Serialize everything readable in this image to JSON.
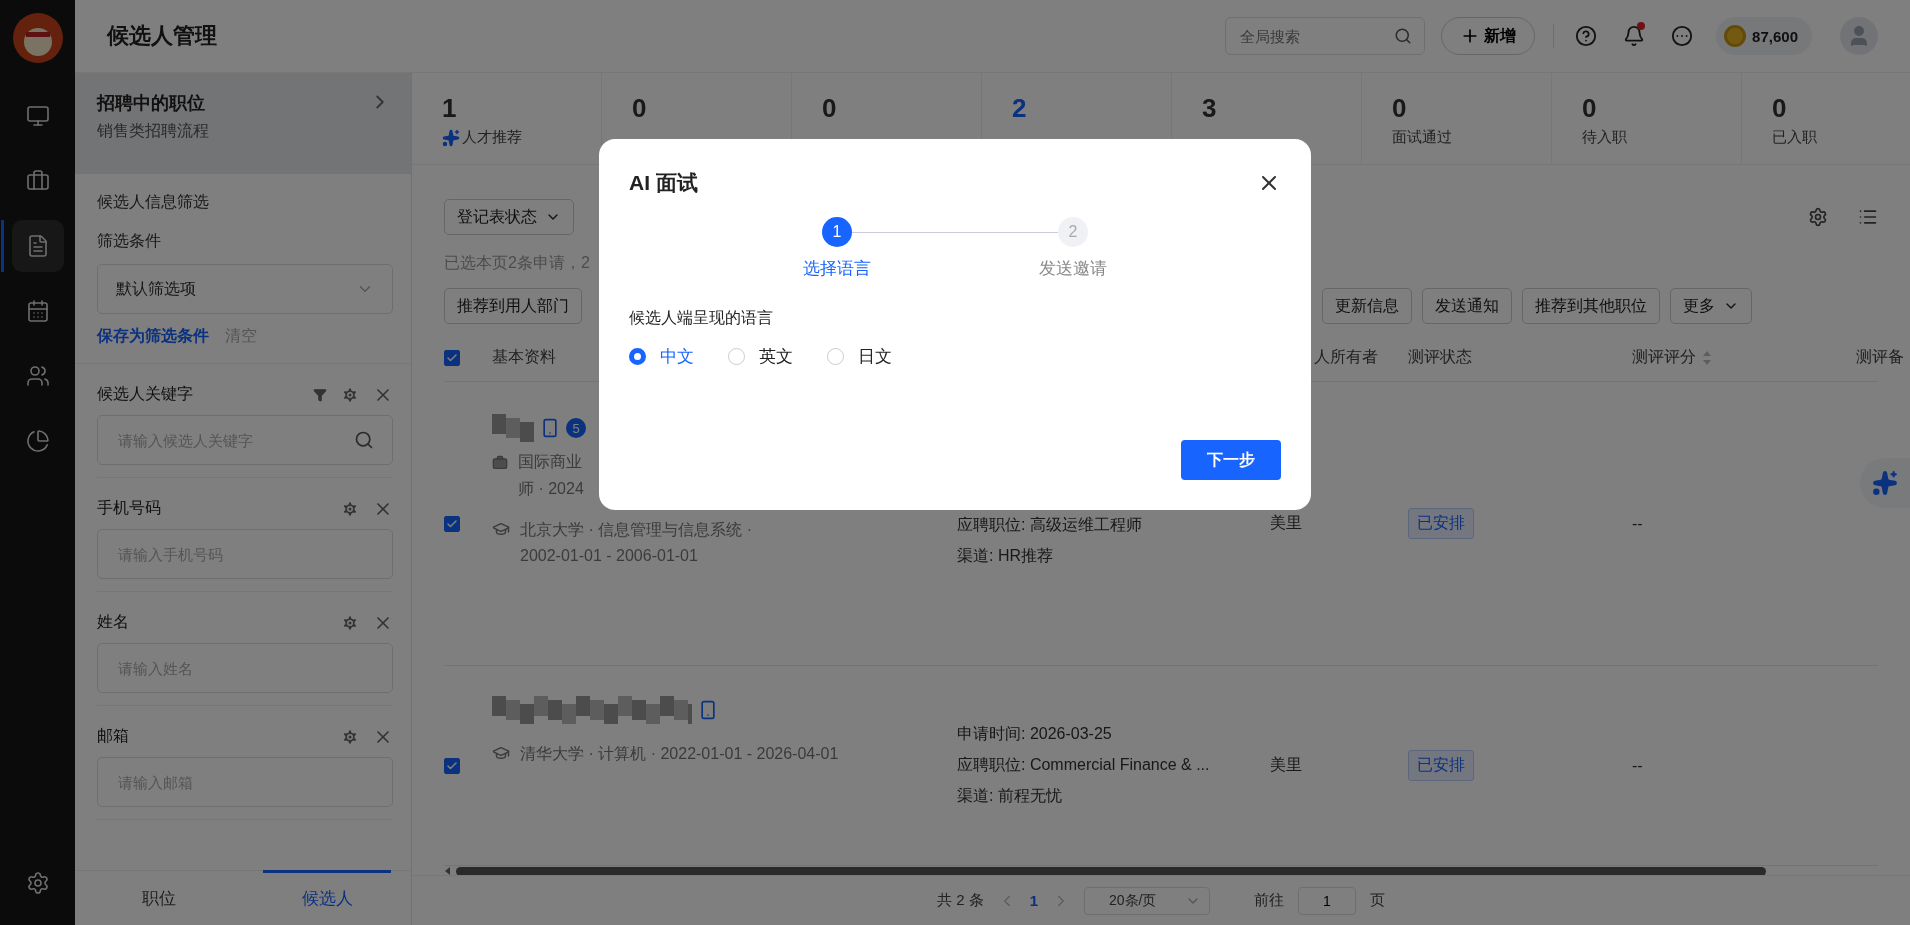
{
  "app": {
    "title": "候选人管理"
  },
  "topbar": {
    "search": {
      "placeholder": "全局搜索"
    },
    "add_button": "新增",
    "notification_dot": true,
    "coins": "87,600"
  },
  "nav": [
    {
      "selected": false
    },
    {
      "selected": false
    },
    {
      "selected": true
    },
    {
      "selected": false
    },
    {
      "selected": false
    },
    {
      "selected": false
    }
  ],
  "panel": {
    "position": {
      "title": "招聘中的职位",
      "subtitle": "销售类招聘流程"
    },
    "section_title": "候选人信息筛选",
    "filter_label": "筛选条件",
    "filter_select": "默认筛选项",
    "save_link": "保存为筛选条件",
    "clear_link": "清空",
    "fields": [
      {
        "label": "候选人关键字",
        "placeholder": "请输入候选人关键字",
        "kind": "search"
      },
      {
        "label": "手机号码",
        "placeholder": "请输入手机号码",
        "kind": "text"
      },
      {
        "label": "姓名",
        "placeholder": "请输入姓名",
        "kind": "text"
      },
      {
        "label": "邮箱",
        "placeholder": "请输入邮箱",
        "kind": "text"
      }
    ],
    "tabs": [
      {
        "label": "职位",
        "selected": false
      },
      {
        "label": "候选人",
        "selected": true
      }
    ]
  },
  "stages": [
    {
      "count": "1",
      "label": "人才推荐",
      "kind": "ai",
      "selected": false
    },
    {
      "count": "0",
      "selected": false
    },
    {
      "count": "0",
      "selected": false
    },
    {
      "count": "2",
      "selected": true
    },
    {
      "count": "3",
      "selected": false
    },
    {
      "count": "0",
      "label": "面试通过",
      "kind": "plain",
      "selected": false
    },
    {
      "count": "0",
      "label": "待入职",
      "kind": "plain",
      "selected": false
    },
    {
      "count": "0",
      "label": "已入职",
      "kind": "plain",
      "selected": false
    }
  ],
  "toolbar": {
    "filters": [
      "登记表状态"
    ],
    "selection_note": "已选本页2条申请，2",
    "actions": [
      {
        "label": "推荐到用人部门",
        "dropdown": false
      },
      {
        "label": "更新信息",
        "dropdown": false
      },
      {
        "label": "发送通知",
        "dropdown": false
      },
      {
        "label": "推荐到其他职位",
        "dropdown": false
      },
      {
        "label": "更多",
        "dropdown": true
      }
    ]
  },
  "table": {
    "all_checked": true,
    "columns": [
      {
        "label": "基本资料"
      },
      {
        "label": "人所有者"
      },
      {
        "label": "测评状态"
      },
      {
        "label": "测评评分",
        "sortable": true
      },
      {
        "label": "测评备"
      }
    ],
    "rows": [
      {
        "checked": true,
        "badge": "5",
        "experience": [
          "国际商业",
          "师 · 2024"
        ],
        "education": [
          "北京大学 · 信息管理与信息系统 ·",
          "2002-01-01 - 2006-01-01"
        ],
        "details": [
          "应聘职位: 高级运维工程师",
          "渠道: HR推荐"
        ],
        "owner": "美里",
        "status": "已安排",
        "score": "--"
      },
      {
        "checked": true,
        "education": [
          "清华大学 · 计算机 · 2022-01-01 - 2026-04-01"
        ],
        "details": [
          "申请时间: 2026-03-25",
          "应聘职位: Commercial Finance & ...",
          "渠道: 前程无忧"
        ],
        "owner": "美里",
        "status": "已安排",
        "score": "--"
      }
    ]
  },
  "pagination": {
    "total": "共 2 条",
    "pages": [
      {
        "label": "1",
        "selected": true
      }
    ],
    "page_size": "20条/页",
    "goto_label": "前往",
    "goto_value": "1",
    "goto_suffix": "页"
  },
  "modal": {
    "title": "AI 面试",
    "steps": [
      {
        "number": "1",
        "label": "选择语言",
        "selected": true
      },
      {
        "number": "2",
        "label": "发送邀请",
        "selected": false
      }
    ],
    "question": "候选人端呈现的语言",
    "options": [
      {
        "label": "中文",
        "selected": true
      },
      {
        "label": "英文",
        "selected": false
      },
      {
        "label": "日文",
        "selected": false
      }
    ],
    "next_button": "下一步"
  }
}
